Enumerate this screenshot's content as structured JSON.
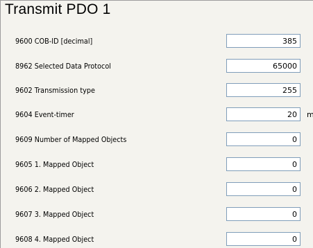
{
  "panel": {
    "title": "Transmit PDO 1"
  },
  "fields": [
    {
      "label": "9600 COB-ID [decimal]",
      "value": "385"
    },
    {
      "label": "8962 Selected Data Protocol",
      "value": "65000"
    },
    {
      "label": "9602 Transmission type",
      "value": "255"
    },
    {
      "label": "9604 Event-timer",
      "value": "20",
      "unit": "m"
    },
    {
      "label": "9609 Number of Mapped Objects",
      "value": "0"
    },
    {
      "label": "9605 1. Mapped Object",
      "value": "0"
    },
    {
      "label": "9606 2. Mapped Object",
      "value": "0"
    },
    {
      "label": "9607 3. Mapped Object",
      "value": "0"
    },
    {
      "label": "9608 4. Mapped Object",
      "value": "0"
    }
  ],
  "colors": {
    "panel_background": "#f4f3ee",
    "field_border": "#7f9db9",
    "field_background": "#ffffff"
  }
}
